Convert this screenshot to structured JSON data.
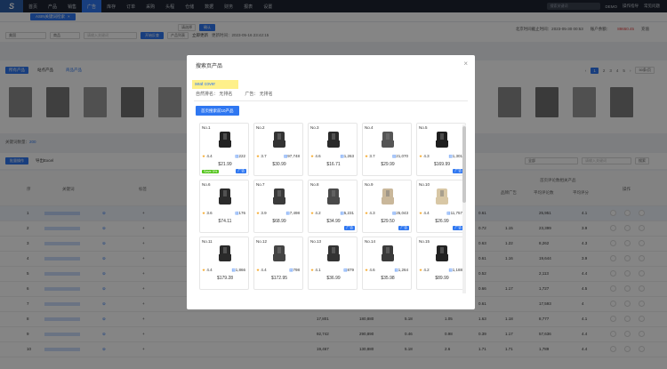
{
  "app": {
    "logo": "S"
  },
  "nav": {
    "items": [
      "首页",
      "产品",
      "销售",
      "广告",
      "库存",
      "订单",
      "采购",
      "头程",
      "仓储",
      "数据",
      "财务",
      "报表",
      "设置"
    ],
    "active_index": 3,
    "search_placeholder": "搜索关键词",
    "demo": "DEMO",
    "help": "操作指导",
    "faq": "常见问题"
  },
  "tab": {
    "label": "ASIN关键词检索"
  },
  "infobar": {
    "select1": "美国",
    "select2": "自动捕捉",
    "select3": "请选择",
    "confirm": "确认",
    "right_text": "北京时间截止时间：2023-05-30 00:53",
    "balance_label": "账户余额：",
    "balance_value": "88650.45",
    "recharge": "充值"
  },
  "filter": {
    "market": "美国",
    "type": "商品",
    "input_placeholder": "请输入关键词",
    "search_btn": "开始反查",
    "product_count": "产品列表",
    "immediate": "立即更新",
    "update_time": "更新时间：2023-05-16 23:42:15"
  },
  "cat": {
    "pills": [
      "所有产品",
      "站点产品",
      "商品产品"
    ],
    "pager": [
      "1",
      "2",
      "3",
      "4",
      "5"
    ],
    "per_page": "50条/页"
  },
  "list": {
    "count_label": "关键词数量：",
    "count_value": "200",
    "batch": "批量操作",
    "export": "导出Excel",
    "scope": "全部",
    "kw_placeholder": "请输入关键词",
    "search": "搜索"
  },
  "table": {
    "headers": [
      "序",
      "关键词",
      "标签",
      "",
      "",
      "",
      "品牌广告",
      "平均评论数",
      "平均评分",
      "操作"
    ],
    "group_header": "首页评论数相关产品",
    "rows": [
      {
        "n": "1",
        "d1": "0.61",
        "d2": "",
        "d3": "25,951",
        "d4": "4.1"
      },
      {
        "n": "2",
        "d1": "0.72",
        "d2": "1.15",
        "d3": "23,399",
        "d4": "3.9"
      },
      {
        "n": "3",
        "d1": "0.63",
        "d2": "1.22",
        "d3": "8,262",
        "d4": "4.3"
      },
      {
        "n": "4",
        "d1": "0.61",
        "d2": "1.16",
        "d3": "19,644",
        "d4": "3.9"
      },
      {
        "n": "5",
        "d1": "0.52",
        "d2": "",
        "d3": "2,113",
        "d4": "4.4"
      },
      {
        "n": "6",
        "d1": "0.66",
        "d2": "1.17",
        "d3": "1,727",
        "d4": "4.5"
      },
      {
        "n": "7",
        "d1": "0.61",
        "d2": "",
        "d3": "17,593",
        "d4": "4"
      },
      {
        "n": "8",
        "d0": "17,801",
        "d5": "180,880",
        "d6": "5.18",
        "d7": "1.05",
        "d1": "1.63",
        "d2": "1.18",
        "d3": "8,777",
        "d4": "4.1"
      },
      {
        "n": "9",
        "d0": "92,742",
        "d5": "290,890",
        "d6": "0.46",
        "d7": "0.98",
        "d1": "0.39",
        "d2": "1.17",
        "d3": "57,636",
        "d4": "4.4"
      },
      {
        "n": "10",
        "d0": "19,467",
        "d5": "130,880",
        "d6": "5.18",
        "d7": "2.6",
        "d1": "1.71",
        "d2": "1.71",
        "d3": "1,789",
        "d4": "4.4"
      }
    ]
  },
  "modal": {
    "title": "搜索页产品",
    "close": "×",
    "keyword": "seat cover",
    "natural_rank": "自然排名：  无排名",
    "ad_rank": "广告：  无排名",
    "button": "首页搜索前10产品",
    "products": [
      {
        "no": "No.1",
        "rating": "4.4",
        "reviews": "222",
        "price": "$21.99",
        "tag": "Save 5%",
        "ad": "广告"
      },
      {
        "no": "No.2",
        "rating": "3.7",
        "reviews": "97,748",
        "price": "$30.99"
      },
      {
        "no": "No.3",
        "rating": "4.6",
        "reviews": "1,263",
        "price": "$16.71"
      },
      {
        "no": "No.4",
        "rating": "3.7",
        "reviews": "21,070",
        "price": "$29.99"
      },
      {
        "no": "No.5",
        "rating": "4.3",
        "reviews": "1,301",
        "price": "$169.99",
        "ad": "广告"
      },
      {
        "no": "No.6",
        "rating": "3.6",
        "reviews": "176",
        "price": "$74.11"
      },
      {
        "no": "No.7",
        "rating": "3.9",
        "reviews": "7,498",
        "price": "$68.99"
      },
      {
        "no": "No.8",
        "rating": "4.2",
        "reviews": "5,231",
        "price": "$34.99",
        "ad": "广告"
      },
      {
        "no": "No.9",
        "rating": "4.3",
        "reviews": "25,043",
        "price": "$29.50",
        "ad": "广告"
      },
      {
        "no": "No.10",
        "rating": "4.4",
        "reviews": "11,757",
        "price": "$26.99",
        "ad": "广告"
      },
      {
        "no": "No.11",
        "rating": "4.4",
        "reviews": "1,866",
        "price": "$179.28"
      },
      {
        "no": "No.12",
        "rating": "4.4",
        "reviews": "798",
        "price": "$172.95"
      },
      {
        "no": "No.13",
        "rating": "4.1",
        "reviews": "879",
        "price": "$36.99"
      },
      {
        "no": "No.14",
        "rating": "4.6",
        "reviews": "1,264",
        "price": "$35.98"
      },
      {
        "no": "No.15",
        "rating": "4.2",
        "reviews": "1,188",
        "price": "$89.99"
      }
    ]
  },
  "colors": {
    "accent": "#2f77f1",
    "nav_bg": "#1e2430",
    "highlight": "#fef08a",
    "star": "#f5a623"
  }
}
